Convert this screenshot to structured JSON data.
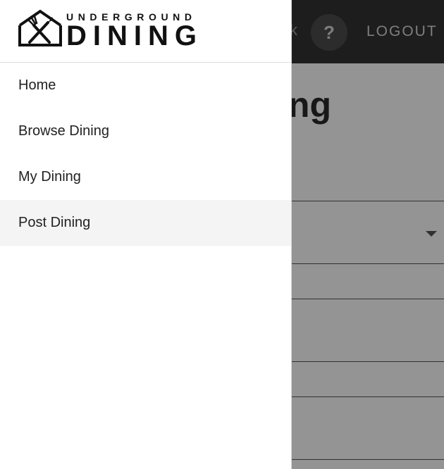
{
  "header": {
    "partial_left_text": "k",
    "help_label": "?",
    "logout_label": "LOGOUT"
  },
  "main": {
    "partial_heading": "ng"
  },
  "drawer": {
    "logo": {
      "top_text": "UNDERGROUND",
      "main_text": "DINING"
    },
    "items": [
      {
        "label": "Home",
        "active": false
      },
      {
        "label": "Browse Dining",
        "active": false
      },
      {
        "label": "My Dining",
        "active": false
      },
      {
        "label": "Post Dining",
        "active": true
      }
    ]
  },
  "colors": {
    "topbar": "#333333",
    "drawer_background": "#ffffff",
    "active_item_background": "#f4f4f4",
    "scrim": "rgba(0,0,0,0.42)"
  }
}
